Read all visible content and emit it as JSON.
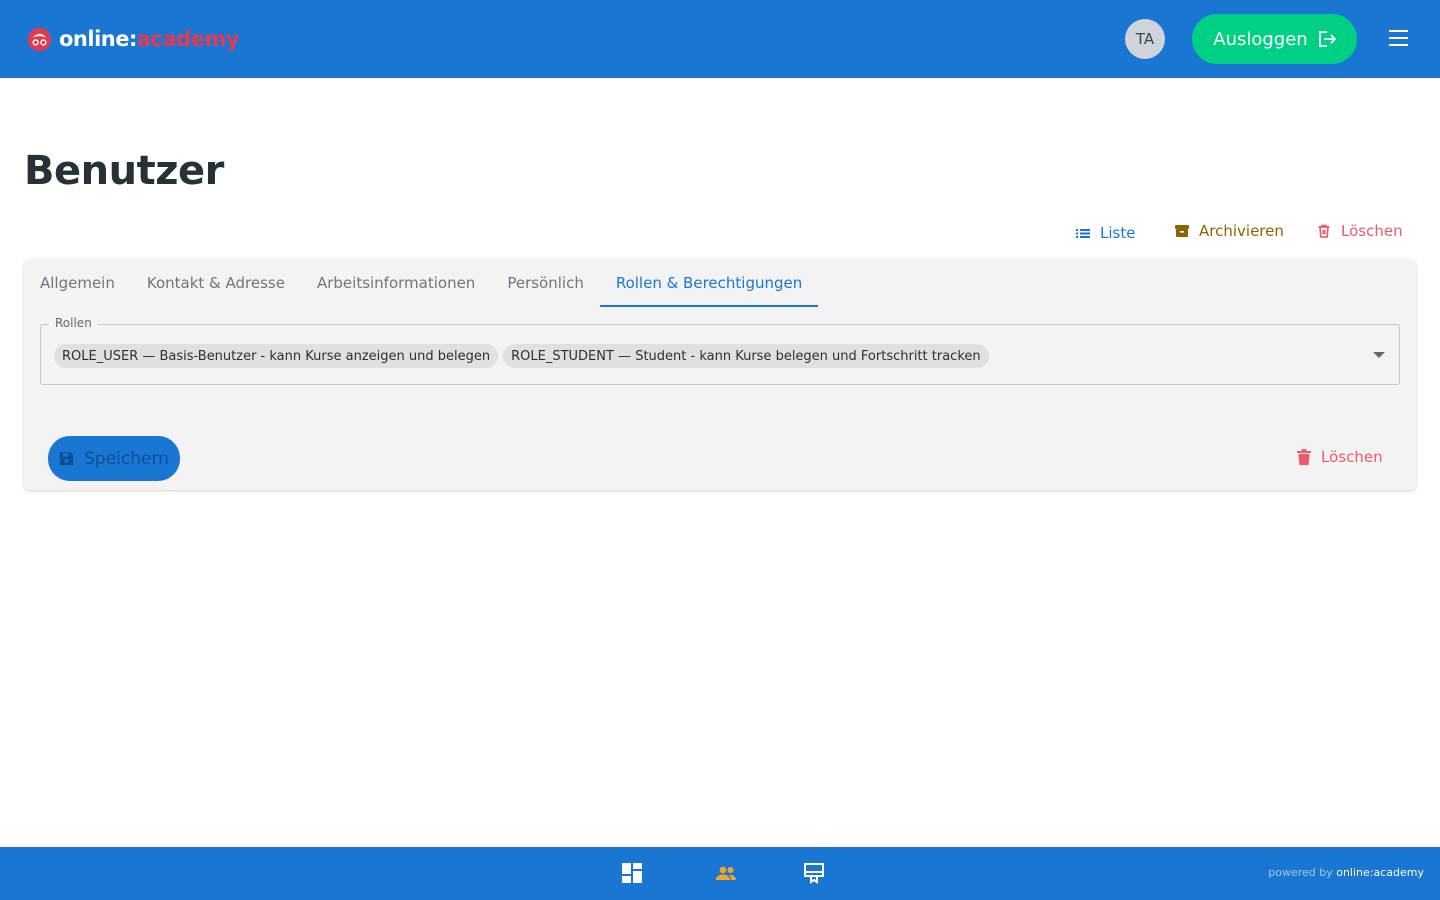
{
  "header": {
    "logo_part1": "online:",
    "logo_part2": "academy",
    "avatar_initials": "TA",
    "logout_label": "Ausloggen"
  },
  "page": {
    "title": "Benutzer"
  },
  "actions": {
    "list_label": "Liste",
    "archive_label": "Archivieren",
    "delete_label": "Löschen"
  },
  "tabs": [
    {
      "label": "Allgemein",
      "active": false
    },
    {
      "label": "Kontakt & Adresse",
      "active": false
    },
    {
      "label": "Arbeitsinformationen",
      "active": false
    },
    {
      "label": "Persönlich",
      "active": false
    },
    {
      "label": "Rollen & Berechtigungen",
      "active": true
    }
  ],
  "roles_field": {
    "label": "Rollen",
    "chips": [
      "ROLE_USER — Basis-Benutzer - kann Kurse anzeigen und belegen",
      "ROLE_STUDENT — Student - kann Kurse belegen und Fortschritt tracken"
    ]
  },
  "form": {
    "save_label": "Speichern",
    "delete_label": "Löschen"
  },
  "footer": {
    "nav_icons": [
      "dashboard-icon",
      "users-icon",
      "courses-icon"
    ],
    "powered_prefix": "powered by ",
    "powered_brand": "online:academy"
  },
  "colors": {
    "primary": "#1976d2",
    "success": "#00d084",
    "danger": "#ec5b6a",
    "warning": "#8a6500",
    "accent_users": "#f5a623"
  }
}
